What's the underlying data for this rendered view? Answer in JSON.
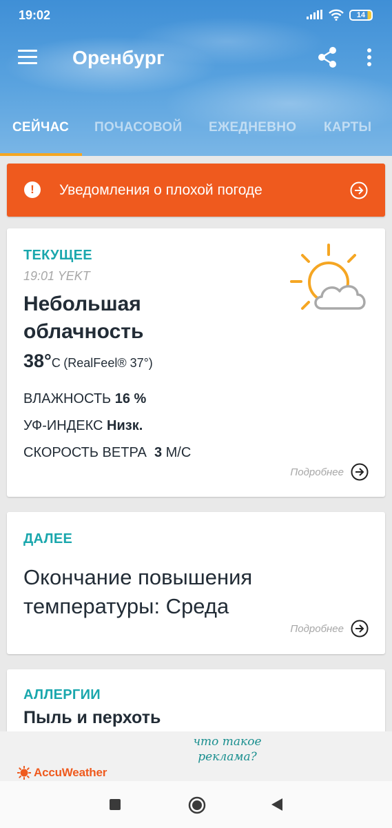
{
  "status_bar": {
    "time": "19:02",
    "battery": "14"
  },
  "app_bar": {
    "city": "Оренбург"
  },
  "tabs": [
    {
      "label": "СЕЙЧАС",
      "active": true
    },
    {
      "label": "ПОЧАСОВОЙ",
      "active": false
    },
    {
      "label": "ЕЖЕДНЕВНО",
      "active": false
    },
    {
      "label": "КАРТЫ",
      "active": false
    }
  ],
  "alert": {
    "text": "Уведомления о плохой погоде",
    "color": "#ef5a1e"
  },
  "current": {
    "title": "ТЕКУЩЕЕ",
    "time": "19:01 YEKT",
    "condition": "Небольшая облачность",
    "temperature": "38°",
    "temp_unit": "C",
    "realfeel": "(RealFeel® 37°)",
    "humidity_label": "ВЛАЖНОСТЬ",
    "humidity_value": "16 %",
    "uv_label": "УФ-ИНДЕКС",
    "uv_value": "Низк.",
    "wind_label": "СКОРОСТЬ ВЕТРА",
    "wind_value": "3",
    "wind_unit": "М/С",
    "more": "Подробнее",
    "icon": "partly-cloudy-icon"
  },
  "next": {
    "title": "ДАЛЕЕ",
    "text": "Окончание повышения температуры: Среда",
    "more": "Подробнее"
  },
  "allergy": {
    "title": "АЛЛЕРГИИ",
    "text": "Пыль и перхоть"
  },
  "ad": {
    "question": "что такое реклама?",
    "brand": "AccuWeather"
  },
  "colors": {
    "accent_teal": "#1aa7ad",
    "brand_orange": "#ef5a1e",
    "tab_indicator": "#f5a623"
  }
}
